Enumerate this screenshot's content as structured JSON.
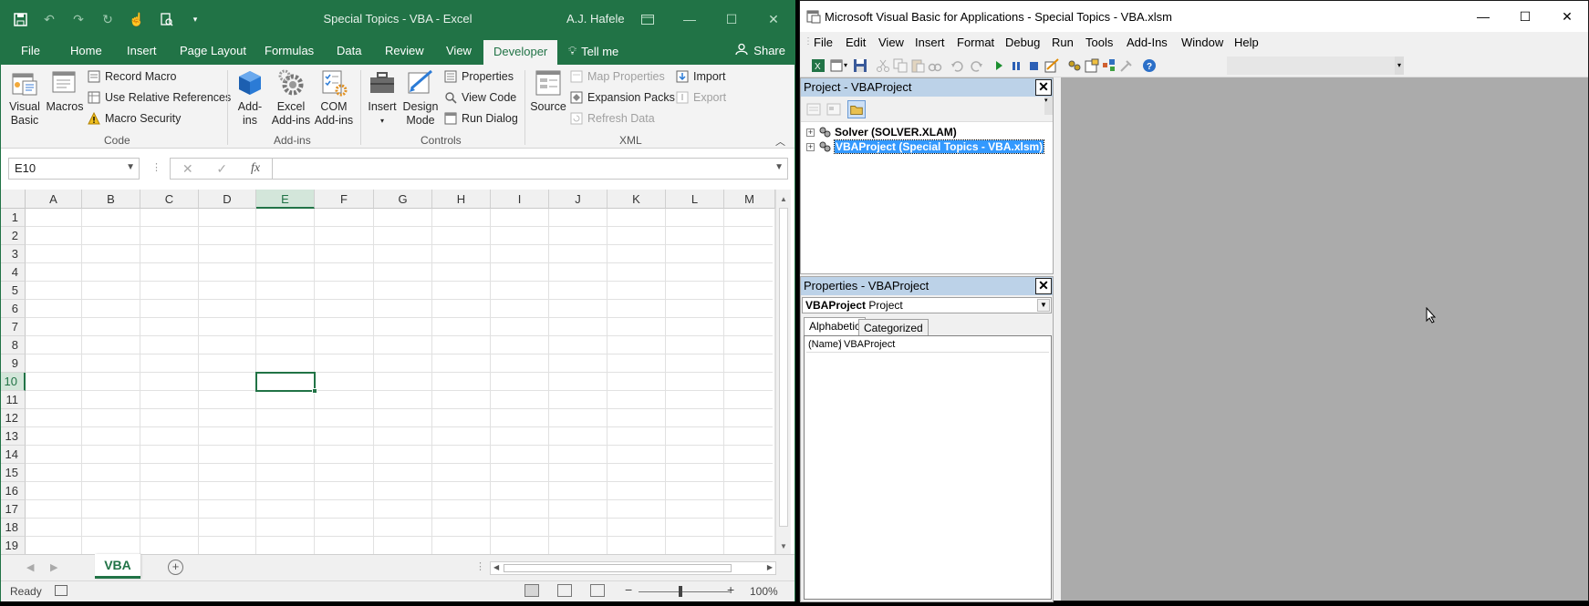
{
  "excel": {
    "title": "Special Topics - VBA  -  Excel",
    "user": "A.J. Hafele",
    "tabs": [
      "File",
      "Home",
      "Insert",
      "Page Layout",
      "Formulas",
      "Data",
      "Review",
      "View",
      "Developer"
    ],
    "tell_me": "Tell me",
    "share": "Share",
    "ribbon": {
      "visual_basic": [
        "Visual",
        "Basic"
      ],
      "macros": "Macros",
      "record_macro": "Record Macro",
      "use_relative": "Use Relative References",
      "macro_security": "Macro Security",
      "addins": [
        "Add-",
        "ins"
      ],
      "excel_addins": [
        "Excel",
        "Add-ins"
      ],
      "com_addins": [
        "COM",
        "Add-ins"
      ],
      "insert": "Insert",
      "design_mode": [
        "Design",
        "Mode"
      ],
      "properties": "Properties",
      "view_code": "View Code",
      "run_dialog": "Run Dialog",
      "source": "Source",
      "map_properties": "Map Properties",
      "expansion_packs": "Expansion Packs",
      "refresh_data": "Refresh Data",
      "import": "Import",
      "export": "Export",
      "groups": {
        "code": "Code",
        "addins": "Add-ins",
        "controls": "Controls",
        "xml": "XML"
      }
    },
    "name_box": "E10",
    "fx": "fx",
    "columns": [
      "A",
      "B",
      "C",
      "D",
      "E",
      "F",
      "G",
      "H",
      "I",
      "J",
      "K",
      "L",
      "M"
    ],
    "rows": [
      "1",
      "2",
      "3",
      "4",
      "5",
      "6",
      "7",
      "8",
      "9",
      "10",
      "11",
      "12",
      "13",
      "14",
      "15",
      "16",
      "17",
      "18",
      "19"
    ],
    "selected_column": "E",
    "selected_row": "10",
    "sheet_tab": "VBA",
    "status": "Ready",
    "zoom": "100%",
    "colors": {
      "brand": "#217346"
    }
  },
  "vbe": {
    "title": "Microsoft Visual Basic for Applications - Special Topics - VBA.xlsm",
    "menus": [
      "File",
      "Edit",
      "View",
      "Insert",
      "Format",
      "Debug",
      "Run",
      "Tools",
      "Add-Ins",
      "Window",
      "Help"
    ],
    "project_title": "Project - VBAProject",
    "tree": [
      {
        "label": "Solver (SOLVER.XLAM)",
        "selected": false
      },
      {
        "label": "VBAProject (Special Topics - VBA.xlsm)",
        "selected": true
      }
    ],
    "properties_title": "Properties - VBAProject",
    "combo_bold": "VBAProject",
    "combo_rest": "Project",
    "tab_alphabetic": "Alphabetic",
    "tab_categorized": "Categorized",
    "prop_name": "(Name)",
    "prop_value": "VBAProject"
  }
}
